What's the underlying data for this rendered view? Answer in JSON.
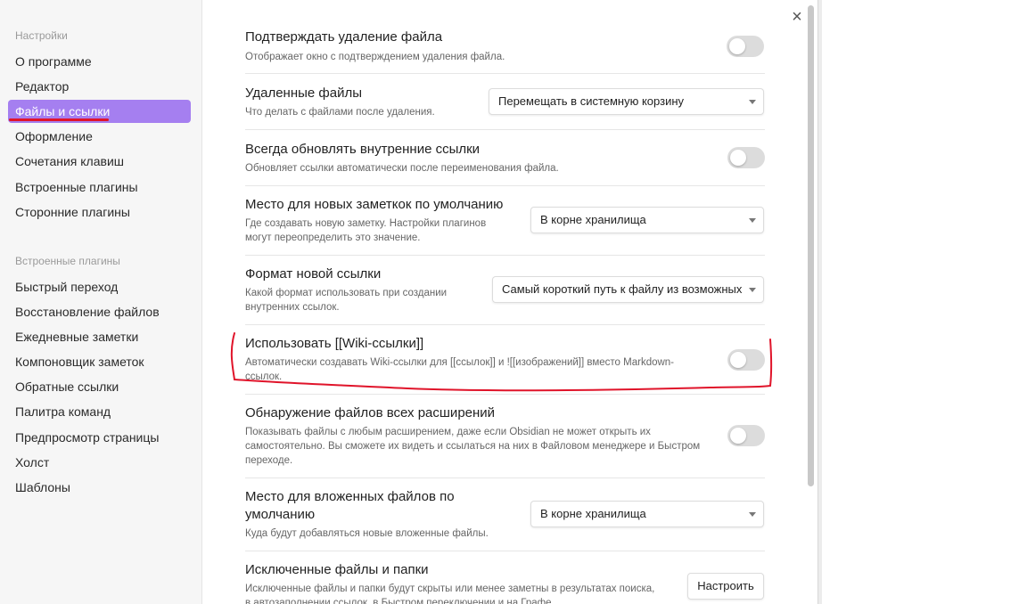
{
  "sidebar": {
    "heading_settings": "Настройки",
    "settings_items": [
      {
        "label": "О программе"
      },
      {
        "label": "Редактор"
      },
      {
        "label": "Файлы и ссылки",
        "active": true
      },
      {
        "label": "Оформление"
      },
      {
        "label": "Сочетания клавиш"
      },
      {
        "label": "Встроенные плагины"
      },
      {
        "label": "Сторонние плагины"
      }
    ],
    "heading_plugins": "Встроенные плагины",
    "plugin_items": [
      {
        "label": "Быстрый переход"
      },
      {
        "label": "Восстановление файлов"
      },
      {
        "label": "Ежедневные заметки"
      },
      {
        "label": "Компоновщик заметок"
      },
      {
        "label": "Обратные ссылки"
      },
      {
        "label": "Палитра команд"
      },
      {
        "label": "Предпросмотр страницы"
      },
      {
        "label": "Холст"
      },
      {
        "label": "Шаблоны"
      }
    ],
    "active_color": "#a57ff0"
  },
  "close_icon": "×",
  "settings": [
    {
      "name": "Подтверждать удаление файла",
      "desc": "Отображает окно с подтверждением удаления файла.",
      "control": "toggle",
      "on": false
    },
    {
      "name": "Удаленные файлы",
      "desc": "Что делать с файлами после удаления.",
      "control": "dropdown",
      "value": "Перемещать в системную корзину"
    },
    {
      "name": "Всегда обновлять внутренние ссылки",
      "desc": "Обновляет ссылки автоматически после переименования файла.",
      "control": "toggle",
      "on": false
    },
    {
      "name": "Место для новых заметкок по умолчанию",
      "desc_line1": "Где создавать новую заметку. Настройки плагинов",
      "desc_line2": "могут переопределить это значение.",
      "control": "dropdown",
      "value": "В корне хранилища"
    },
    {
      "name": "Формат новой ссылки",
      "desc_line1": "Какой формат использовать при создании",
      "desc_line2": "внутренних ссылок.",
      "control": "dropdown",
      "value": "Самый короткий путь к файлу из возможных"
    },
    {
      "name": "Использовать [[Wiki-ссылки]]",
      "desc_line1": "Автоматически создавать Wiki-ссылки для [[ссылок]] и ![[изображений]] вместо Markdown-",
      "desc_line2": "ссылок.",
      "control": "toggle",
      "on": false
    },
    {
      "name": "Обнаружение файлов всех расширений",
      "desc_line1": "Показывать файлы с любым расширением, даже если Obsidian не может открыть их",
      "desc_line2": "самостоятельно. Вы сможете их видеть и ссылаться на них в Файловом менеджере и Быстром",
      "desc_line3": "переходе.",
      "control": "toggle",
      "on": false
    },
    {
      "name_line1": "Место для вложенных файлов по",
      "name_line2": "умолчанию",
      "desc": "Куда будут добавляться новые вложенные файлы.",
      "control": "dropdown",
      "value": "В корне хранилища"
    },
    {
      "name": "Исключенные файлы и папки",
      "desc_line1": "Исключенные файлы и папки будут скрыты или менее заметны в результатах поиска,",
      "desc_line2": "в автозаполнении ссылок, в Быстром переключении и на Графе",
      "control": "button",
      "value": "Настроить"
    }
  ],
  "annotation_color": "#e0142a"
}
